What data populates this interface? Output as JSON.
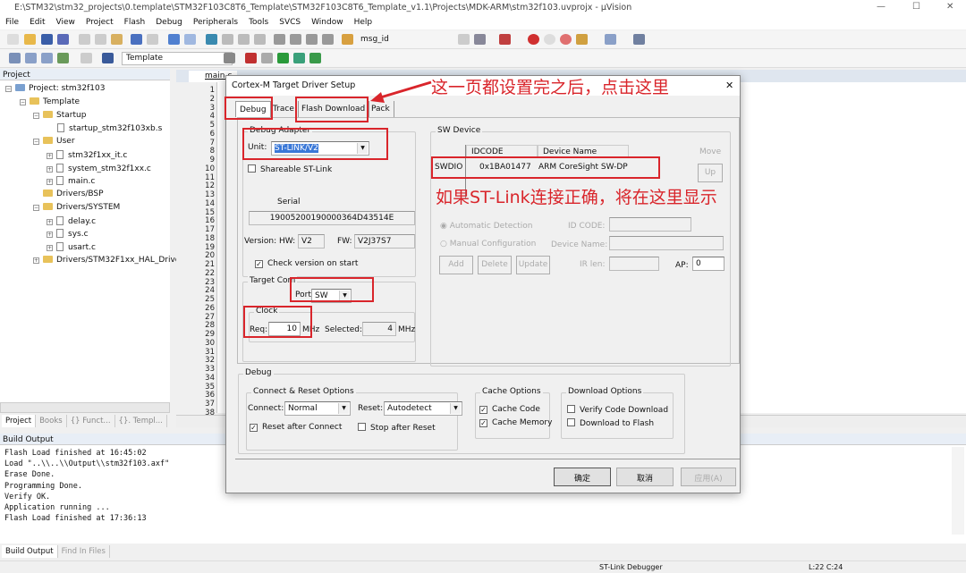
{
  "window": {
    "title": "E:\\STM32\\stm32_projects\\0.template\\STM32F103C8T6_Template\\STM32F103C8T6_Template_v1.1\\Projects\\MDK-ARM\\stm32f103.uvprojx - µVision"
  },
  "menu": [
    "File",
    "Edit",
    "View",
    "Project",
    "Flash",
    "Debug",
    "Peripherals",
    "Tools",
    "SVCS",
    "Window",
    "Help"
  ],
  "toolbar": {
    "find_value": "msg_id",
    "target_value": "Template"
  },
  "project": {
    "header": "Project",
    "root": "Project: stm32f103",
    "target": "Template",
    "groups": [
      {
        "name": "Startup",
        "files": [
          "startup_stm32f103xb.s"
        ]
      },
      {
        "name": "User",
        "files": [
          "stm32f1xx_it.c",
          "system_stm32f1xx.c",
          "main.c"
        ]
      },
      {
        "name": "Drivers/BSP",
        "files": []
      },
      {
        "name": "Drivers/SYSTEM",
        "files": [
          "delay.c",
          "sys.c",
          "usart.c"
        ]
      },
      {
        "name": "Drivers/STM32F1xx_HAL_Driver",
        "files": []
      }
    ],
    "tabs": [
      "Project",
      "Books",
      "{} Funct...",
      "{}. Templ..."
    ]
  },
  "editor": {
    "tab": "main.c"
  },
  "build": {
    "header": "Build Output",
    "lines": [
      "Flash Load finished at 16:45:02",
      "Load \"..\\\\..\\\\Output\\\\stm32f103.axf\"",
      "Erase Done.",
      "Programming Done.",
      "Verify OK.",
      "Application running ...",
      "Flash Load finished at 17:36:13"
    ],
    "tabs": [
      "Build Output",
      "Find In Files"
    ]
  },
  "status": {
    "debugger": "ST-Link Debugger",
    "position": "L:22 C:24"
  },
  "dialog": {
    "title": "Cortex-M Target Driver Setup",
    "tabs": [
      "Debug",
      "Trace",
      "Flash Download",
      "Pack"
    ],
    "adapter": {
      "label": "Debug Adapter",
      "unit_label": "Unit:",
      "unit_value": "ST-LINK/V2",
      "shareable": "Shareable ST-Link",
      "serial_label": "Serial",
      "serial": "19005200190000364D43514E",
      "version_label": "Version: HW:",
      "hw": "V2",
      "fw_label": "FW:",
      "fw": "V2J37S7",
      "check_version": "Check version on start"
    },
    "target": {
      "label": "Target Com",
      "port_label": "Port:",
      "port_value": "SW",
      "clock_label": "Clock",
      "req_label": "Req:",
      "req_value": "10",
      "mhz": "MHz",
      "selected_label": "Selected:",
      "selected_value": "4"
    },
    "swdevice": {
      "label": "SW Device",
      "col_idcode": "IDCODE",
      "col_name": "Device Name",
      "row_label": "SWDIO",
      "idcode": "0x1BA01477",
      "device": "ARM CoreSight SW-DP",
      "move": "Move",
      "up": "Up",
      "auto": "Automatic Detection",
      "manual": "Manual Configuration",
      "id_code_label": "ID CODE:",
      "device_name_label": "Device Name:",
      "add": "Add",
      "delete": "Delete",
      "update": "Update",
      "ir_len": "IR len:",
      "ap_label": "AP:",
      "ap_value": "0"
    },
    "debug": {
      "label": "Debug",
      "connect_group": "Connect & Reset Options",
      "connect_label": "Connect:",
      "connect_value": "Normal",
      "reset_label": "Reset:",
      "reset_value": "Autodetect",
      "reset_after": "Reset after Connect",
      "stop_after": "Stop after Reset",
      "cache_group": "Cache Options",
      "cache_code": "Cache Code",
      "cache_memory": "Cache Memory",
      "download_group": "Download Options",
      "verify": "Verify Code Download",
      "download_flash": "Download to Flash"
    },
    "buttons": {
      "ok": "确定",
      "cancel": "取消",
      "apply": "应用(A)"
    }
  },
  "annotations": {
    "top": "这一页都设置完之后，点击这里",
    "middle": "如果ST-Link连接正确，将在这里显示",
    "color": "#d9252b"
  }
}
